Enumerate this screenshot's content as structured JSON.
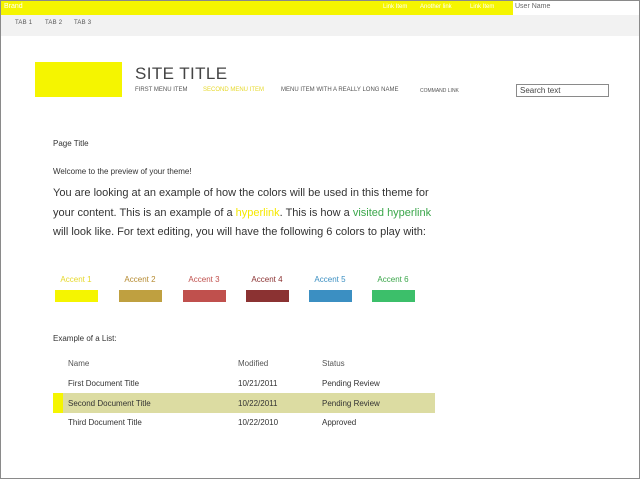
{
  "topbar": {
    "brand": "Brand",
    "links": [
      "Link Item",
      "Another link",
      "Link Item"
    ],
    "user": "User Name"
  },
  "tabs": [
    "TAB 1",
    "TAB 2",
    "TAB 3"
  ],
  "site": {
    "title": "SITE TITLE",
    "menu": [
      "FIRST MENU ITEM",
      "SECOND MENU ITEM",
      "MENU ITEM WITH A REALLY LONG NAME",
      "COMMAND LINK"
    ],
    "search_placeholder": "Search text"
  },
  "content": {
    "page_title": "Page Title",
    "welcome": "Welcome to the preview of your theme!",
    "para_1": "You are looking at an example of how the colors will be used in this theme for your content. This is an example of a ",
    "link_text": "hyperlink",
    "para_2": ". This is how a ",
    "visited_text": "visited hyperlink",
    "para_3": " will look like. For text editing, you will have the following 6 colors to play with:"
  },
  "accents": [
    {
      "label": "Accent 1",
      "color": "#f5f500",
      "text_color": "#e6d82a"
    },
    {
      "label": "Accent 2",
      "color": "#bfa040",
      "text_color": "#b58a30"
    },
    {
      "label": "Accent 3",
      "color": "#c0504d",
      "text_color": "#c0504d"
    },
    {
      "label": "Accent 4",
      "color": "#8b3232",
      "text_color": "#8b3232"
    },
    {
      "label": "Accent 5",
      "color": "#3b8fc2",
      "text_color": "#3b8fc2"
    },
    {
      "label": "Accent 6",
      "color": "#3cbf6a",
      "text_color": "#3aa64a"
    }
  ],
  "list": {
    "heading": "Example of a List:",
    "columns": [
      "Name",
      "Modified",
      "Status"
    ],
    "rows": [
      {
        "name": "First Document Title",
        "modified": "10/21/2011",
        "status": "Pending Review"
      },
      {
        "name": "Second Document Title",
        "modified": "10/22/2011",
        "status": "Pending Review"
      },
      {
        "name": "Third Document Title",
        "modified": "10/22/2010",
        "status": "Approved"
      }
    ]
  }
}
